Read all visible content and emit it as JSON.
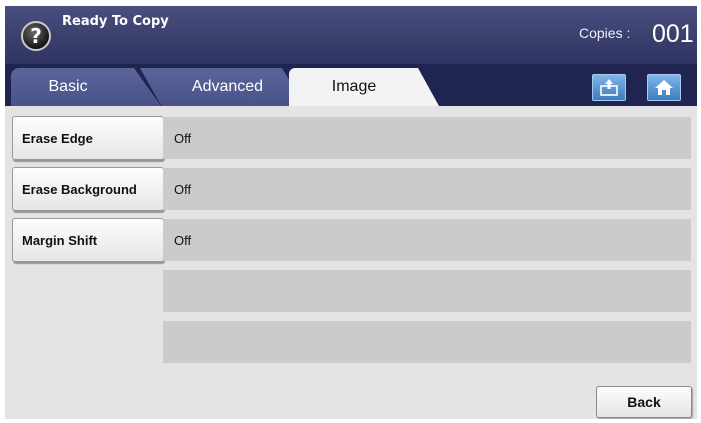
{
  "header": {
    "status": "Ready To Copy",
    "help_icon": "question-mark-icon",
    "help_symbol": "?",
    "copies_label": "Copies :",
    "copies_value": "001"
  },
  "tabs": [
    {
      "label": "Basic",
      "active": false
    },
    {
      "label": "Advanced",
      "active": false
    },
    {
      "label": "Image",
      "active": true
    }
  ],
  "toolbar": {
    "copy_stack_icon": "copy-stack-icon",
    "home_icon": "home-icon"
  },
  "rows": [
    {
      "label": "Erase Edge",
      "value": "Off"
    },
    {
      "label": "Erase Background",
      "value": "Off"
    },
    {
      "label": "Margin Shift",
      "value": "Off"
    },
    {
      "label": "",
      "value": ""
    },
    {
      "label": "",
      "value": ""
    }
  ],
  "footer": {
    "back_label": "Back"
  },
  "colors": {
    "header": "#3a3f6c",
    "tabbar": "#1f2550",
    "tab_inactive": "#4f5890",
    "tab_active": "#f3f3f3",
    "panel": "#e4e4e4",
    "value_strip": "#cbcbcb",
    "icon_button": "#5a9ad8"
  }
}
